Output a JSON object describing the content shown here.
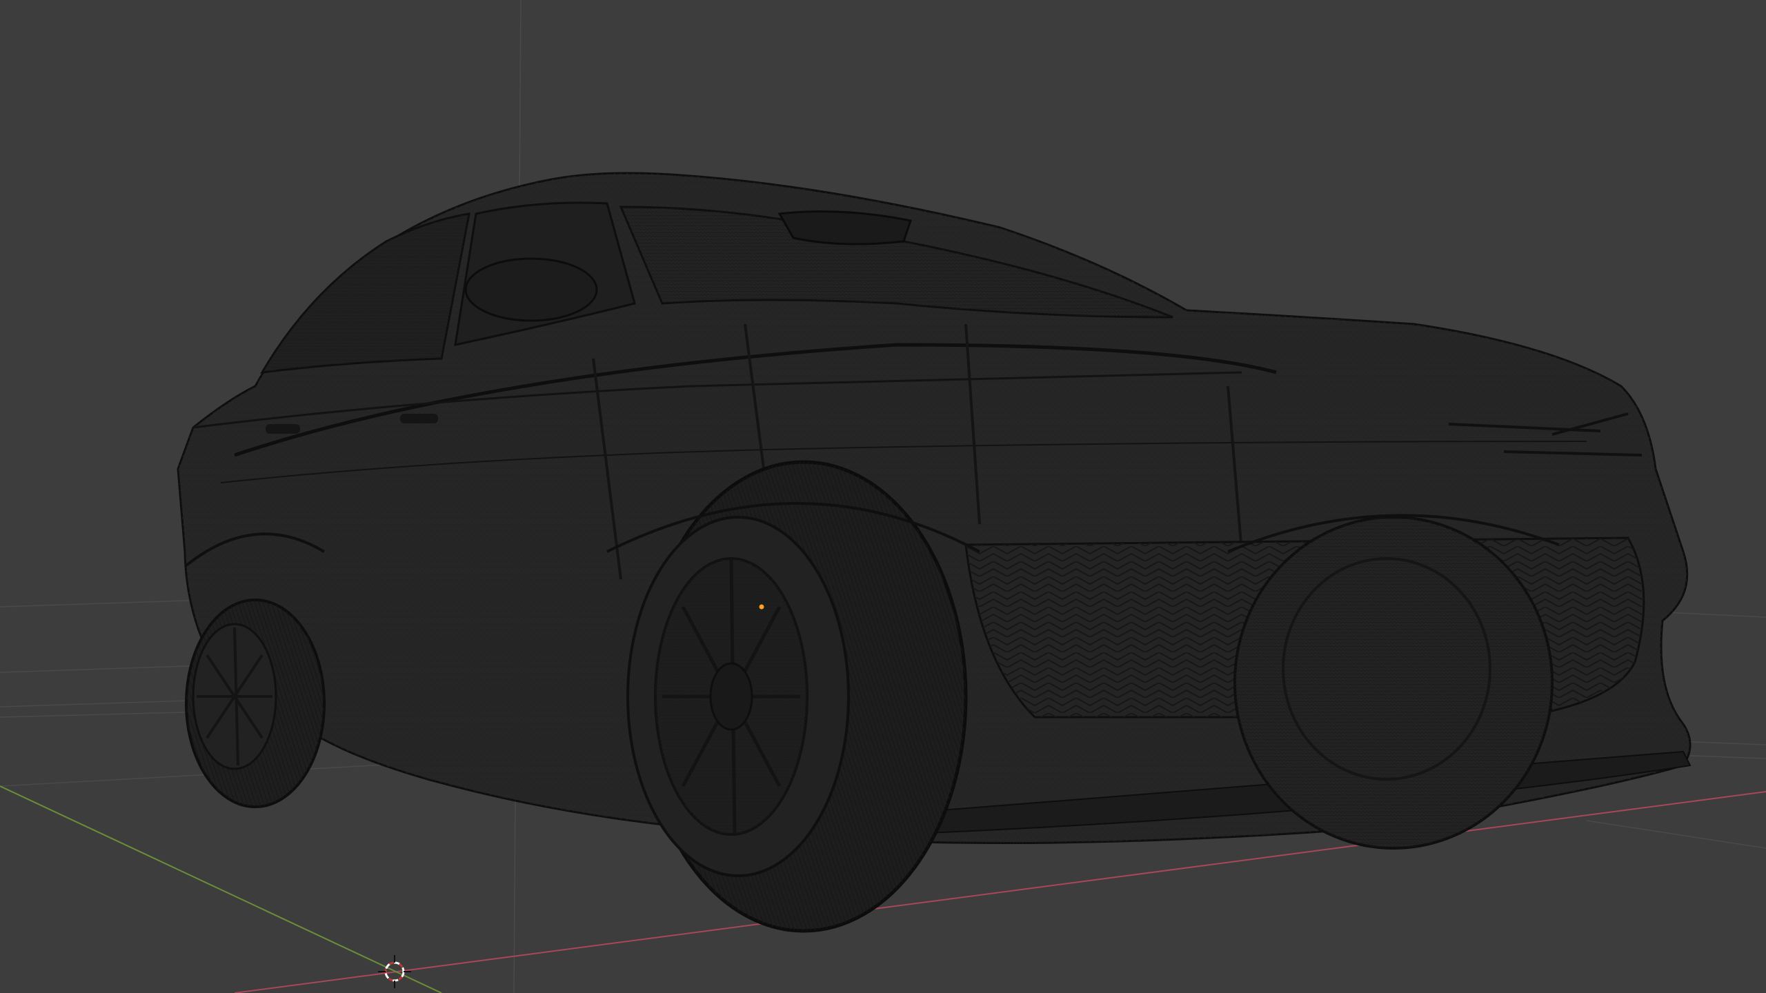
{
  "viewport": {
    "mode": "3D viewport",
    "shading": "wireframe",
    "object": "car-model",
    "background_color": "#3d3d3d",
    "wire_color": "#111111",
    "axis_x_color": "#a8485a",
    "axis_y_color": "#6c8e3a",
    "grid_color": "#4a4a4a",
    "origin_color": "#ffa01e",
    "cursor_colors": [
      "#ffffff",
      "#c83232"
    ]
  }
}
